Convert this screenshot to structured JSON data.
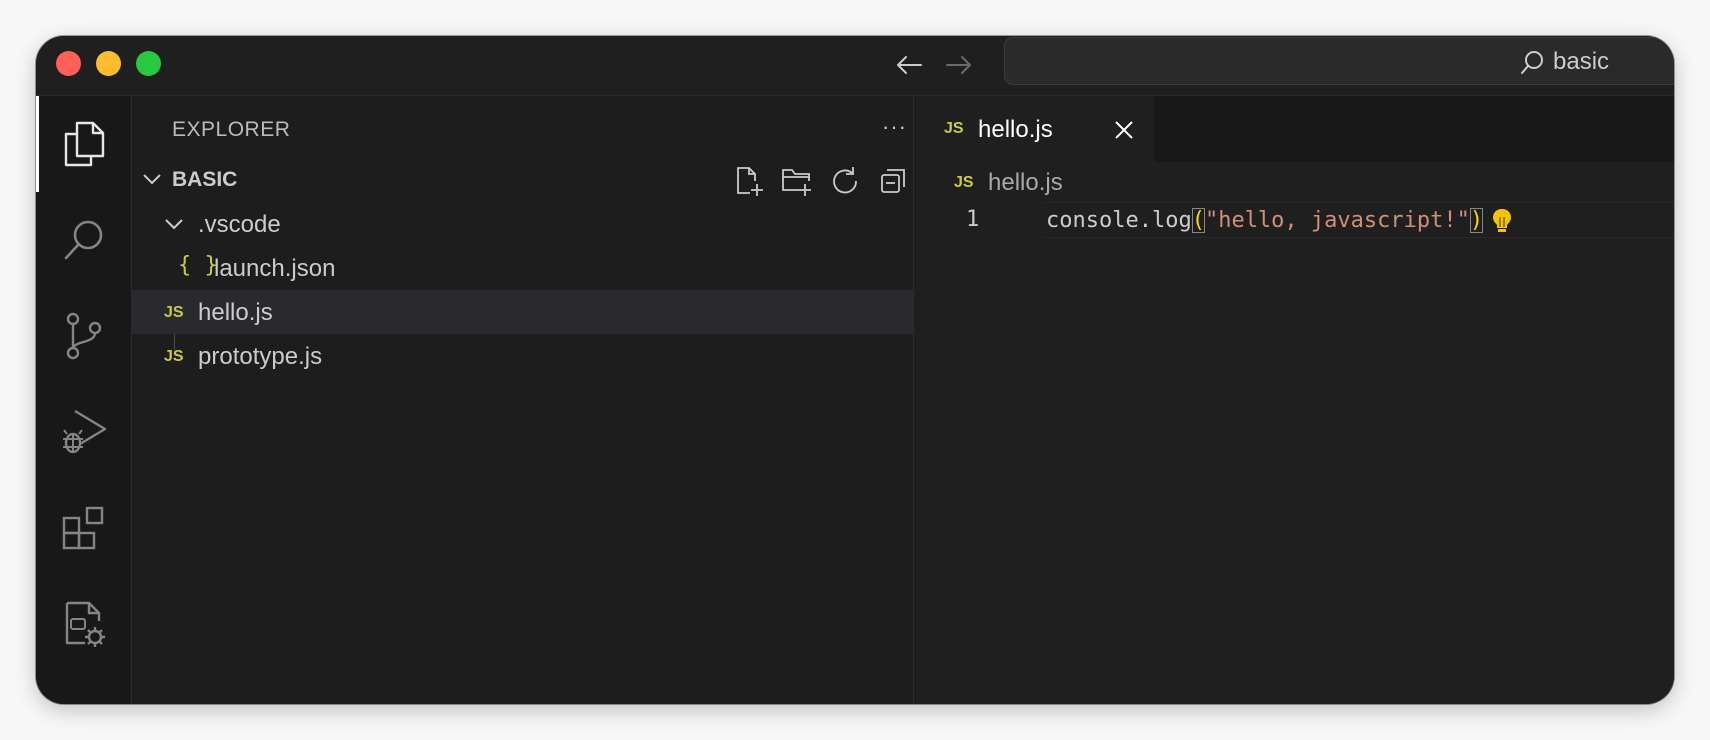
{
  "titlebar": {
    "search_text": "basic"
  },
  "activity_bar": {
    "items": [
      "explorer",
      "search",
      "source-control",
      "run-and-debug",
      "extensions",
      "remote-explorer"
    ]
  },
  "sidebar": {
    "header": "EXPLORER",
    "more_label": "···",
    "folder_name": "BASIC",
    "tree": [
      {
        "label": ".vscode",
        "type": "folder",
        "expanded": true
      },
      {
        "label": "launch.json",
        "type": "json",
        "icon": "{ }"
      },
      {
        "label": "hello.js",
        "type": "js",
        "icon": "JS",
        "selected": true
      },
      {
        "label": "prototype.js",
        "type": "js",
        "icon": "JS"
      }
    ]
  },
  "editor": {
    "tab_label": "hello.js",
    "tab_icon": "JS",
    "breadcrumb": "hello.js",
    "breadcrumb_icon": "JS",
    "lines": [
      {
        "number": "1",
        "code_plain": "console.log",
        "paren_open": "(",
        "string": "\"hello, javascript!\"",
        "paren_close": ")"
      }
    ]
  },
  "colors": {
    "js_badge": "#cbcb41",
    "string": "#ce9178",
    "bracket": "#ffd700",
    "bulb": "#f5c400"
  }
}
